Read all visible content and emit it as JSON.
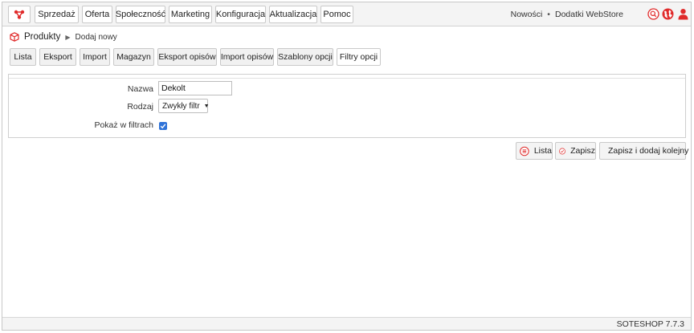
{
  "nav": {
    "items": [
      {
        "label": "Sprzedaż"
      },
      {
        "label": "Oferta"
      },
      {
        "label": "Społeczność"
      },
      {
        "label": "Marketing"
      },
      {
        "label": "Konfiguracja"
      },
      {
        "label": "Aktualizacja"
      },
      {
        "label": "Pomoc"
      }
    ],
    "news_link": "Nowości",
    "separator": "•",
    "addons_link": "Dodatki WebStore"
  },
  "breadcrumb": {
    "section": "Produkty",
    "arrow": "▶",
    "current": "Dodaj nowy"
  },
  "tabs": [
    {
      "label": "Lista"
    },
    {
      "label": "Eksport"
    },
    {
      "label": "Import"
    },
    {
      "label": "Magazyn"
    },
    {
      "label": "Eksport opisów"
    },
    {
      "label": "Import opisów"
    },
    {
      "label": "Szablony opcji"
    },
    {
      "label": "Filtry opcji",
      "active": true
    }
  ],
  "form": {
    "name_label": "Nazwa",
    "name_value": "Dekolt",
    "type_label": "Rodzaj",
    "type_value": "Zwykły filtr",
    "show_label": "Pokaż w filtrach",
    "show_checked": true
  },
  "actions": {
    "list_label": "Lista",
    "save_label": "Zapisz",
    "save_add_label": "Zapisz i dodaj kolejny"
  },
  "footer": {
    "version": "SOTESHOP 7.7.3"
  },
  "colors": {
    "accent": "#e02b2b",
    "checkbox": "#2f73d8"
  }
}
